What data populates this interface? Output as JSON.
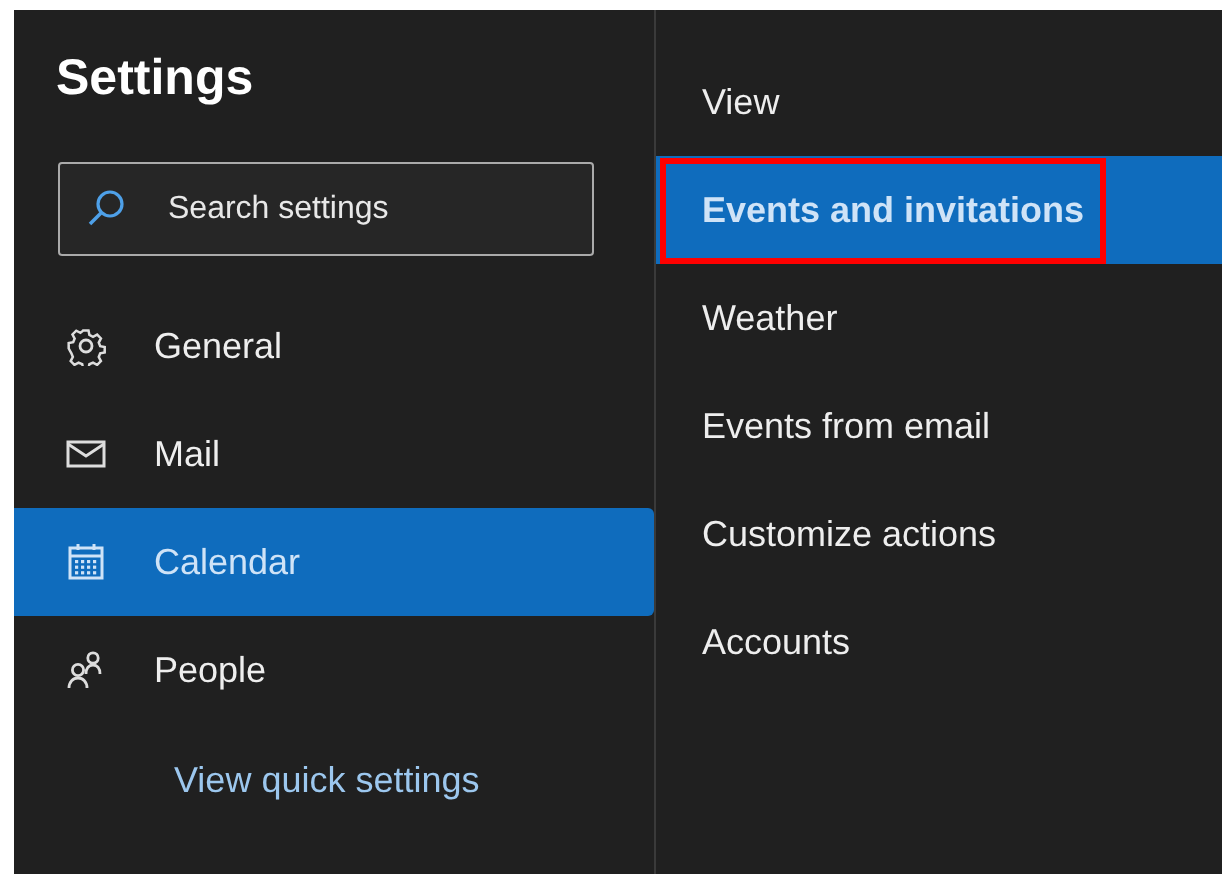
{
  "title": "Settings",
  "search": {
    "placeholder": "Search settings"
  },
  "nav": [
    {
      "label": "General",
      "kind": "gear",
      "selected": false
    },
    {
      "label": "Mail",
      "kind": "mail",
      "selected": false
    },
    {
      "label": "Calendar",
      "kind": "calendar",
      "selected": true
    },
    {
      "label": "People",
      "kind": "people",
      "selected": false
    }
  ],
  "quick_link": "View quick settings",
  "subnav": [
    {
      "label": "View",
      "selected": false,
      "highlighted": false
    },
    {
      "label": "Events and invitations",
      "selected": true,
      "highlighted": true
    },
    {
      "label": "Weather",
      "selected": false,
      "highlighted": false
    },
    {
      "label": "Events from email",
      "selected": false,
      "highlighted": false
    },
    {
      "label": "Customize actions",
      "selected": false,
      "highlighted": false
    },
    {
      "label": "Accounts",
      "selected": false,
      "highlighted": false
    }
  ]
}
